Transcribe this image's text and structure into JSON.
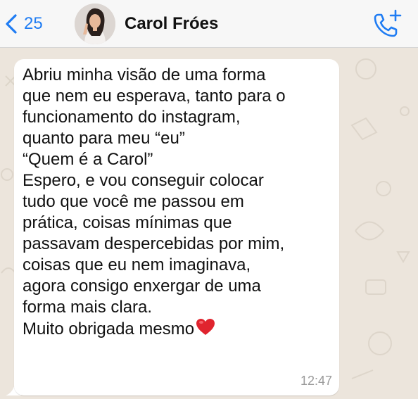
{
  "header": {
    "back_count": "25",
    "contact_name": "Carol Fróes"
  },
  "message": {
    "lines": [
      "Abriu minha visão de uma forma",
      "que nem eu esperava, tanto para o",
      "funcionamento do instagram,",
      "quanto para meu “eu”",
      "“Quem é a Carol”",
      "Espero, e vou conseguir colocar",
      "tudo que você me passou em",
      "prática, coisas mínimas que",
      "passavam despercebidas por mim,",
      "coisas que eu nem imaginava,",
      "agora consigo enxergar de uma",
      "forma mais clara.",
      "Muito obrigada mesmo"
    ],
    "emoji": "red-heart-icon",
    "time": "12:47"
  },
  "colors": {
    "accent": "#1f7cf3",
    "wallpaper": "#ece5dc",
    "bubble": "#ffffff",
    "heart": "#e0242e"
  }
}
